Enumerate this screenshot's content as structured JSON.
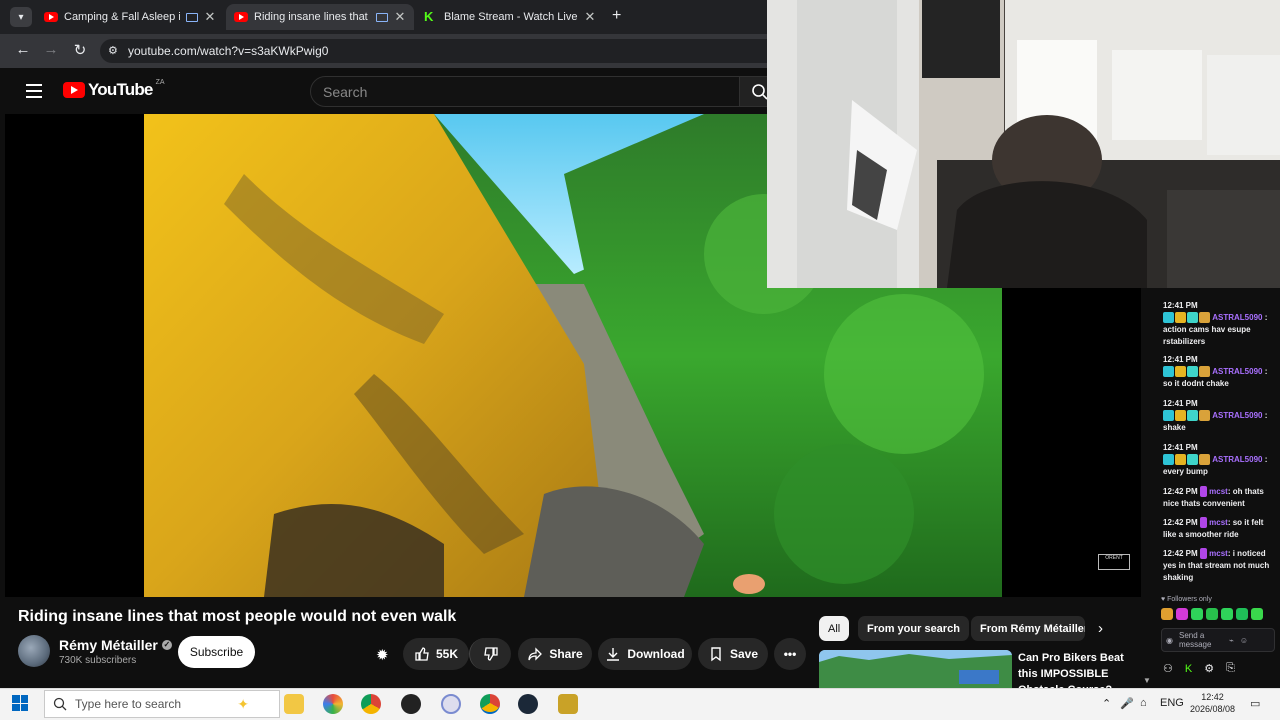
{
  "browser": {
    "tabs": [
      {
        "title": "Camping & Fall Asleep in H",
        "active": false,
        "favicon": "youtube-icon",
        "casting": true
      },
      {
        "title": "Riding insane lines that mo",
        "active": true,
        "favicon": "youtube-icon",
        "casting": true
      },
      {
        "title": "Blame Stream - Watch Live on K",
        "active": false,
        "favicon": "kick-icon",
        "casting": false
      }
    ],
    "url": "youtube.com/watch?v=s3aKWkPwig0"
  },
  "youtube": {
    "logo_text": "YouTube",
    "country_code": "ZA",
    "search_placeholder": "Search",
    "video": {
      "title": "Riding insane lines that most people would not even walk",
      "channel": "Rémy Métailler",
      "subscribers": "730K subscribers",
      "subscribe_label": "Subscribe",
      "likes": "55K",
      "share_label": "Share",
      "download_label": "Download",
      "save_label": "Save",
      "watermark": "ORENT"
    },
    "chips": [
      {
        "label": "All",
        "active": true
      },
      {
        "label": "From your search",
        "active": false
      },
      {
        "label": "From Rémy Métailler",
        "active": false
      }
    ],
    "recommendation": {
      "title": "Can Pro Bikers Beat this IMPOSSIBLE Obstacle Course?"
    }
  },
  "chat": {
    "messages": [
      {
        "time": "12:41 PM",
        "user": "ASTRAL5090",
        "text": ": action cams hav esupe rstabilizers"
      },
      {
        "time": "12:41 PM",
        "user": "ASTRAL5090",
        "text": ": so it dodnt chake"
      },
      {
        "time": "12:41 PM",
        "user": "ASTRAL5090",
        "text": ": shake"
      },
      {
        "time": "12:41 PM",
        "user": "ASTRAL5090",
        "text": ": every bump"
      },
      {
        "time": "12:42 PM",
        "user": "mcst",
        "text": ": oh thats nice thats convenient"
      },
      {
        "time": "12:42 PM",
        "user": "mcst",
        "text": ": so it felt like a smoother ride"
      },
      {
        "time": "12:42 PM",
        "user": "mcst",
        "text": ": i noticed yes in that stream not much shaking"
      }
    ],
    "followers_only": "Followers only",
    "input_placeholder": "Send a message"
  },
  "taskbar": {
    "search_placeholder": "Type here to search",
    "language": "ENG",
    "time": "12:42",
    "date": "2026/08/08"
  },
  "colors": {
    "youtube_red": "#ff0000",
    "kick_green": "#53fc18",
    "twitch_purple": "#a970ff"
  }
}
